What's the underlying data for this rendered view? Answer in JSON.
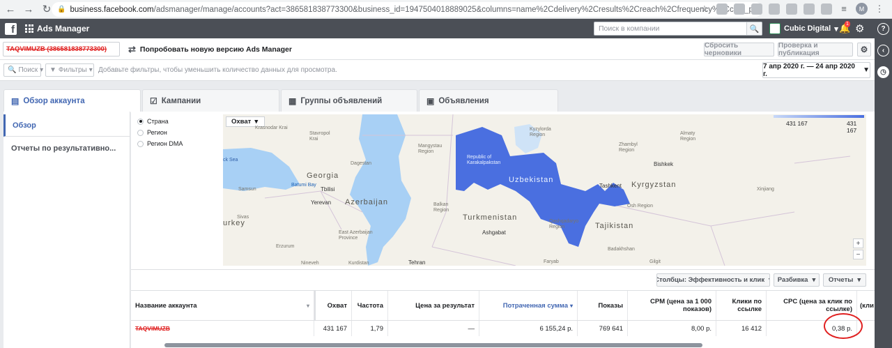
{
  "browser": {
    "url_host": "business.facebook.com",
    "url_path": "/adsmanager/manage/accounts?act=386581838773300&business_id=1947504018889025&columns=name%2Cdelivery%2Cresults%2Creach%2Cfrequency%2Ccost_per_result%2Cbudget%2Cspend%2Cend_...",
    "profile_initial": "M"
  },
  "topbar": {
    "app_title": "Ads Manager",
    "search_placeholder": "Поиск в компании",
    "account_name": "Cubic Digital",
    "notification_count": "1"
  },
  "toolbar": {
    "account_select": "TAQVIMUZB (386581838773300)",
    "try_new": "Попробовать новую версию Ads Manager",
    "reset_drafts": "Сбросить черновики",
    "review_publish": "Проверка и публикация"
  },
  "filters": {
    "search": "Поиск",
    "filters": "Фильтры",
    "hint": "Добавьте фильтры, чтобы уменьшить количество данных для просмотра.",
    "date_range": "7 апр 2020 г. — 24 апр 2020 г."
  },
  "tabs": [
    {
      "label": "Обзор аккаунта"
    },
    {
      "label": "Кампании"
    },
    {
      "label": "Группы объявлений"
    },
    {
      "label": "Объявления"
    }
  ],
  "leftnav": {
    "overview": "Обзор",
    "reports": "Отчеты по результативно..."
  },
  "geo": {
    "options": [
      "Страна",
      "Регион",
      "Регион DMA"
    ],
    "selected": "Страна",
    "metric": "Охват",
    "legend_min": "431 167",
    "legend_max": "431 167",
    "highlight_color": "#4a6fe0",
    "labels": {
      "uzbekistan": "Uzbekistan",
      "karakalpakstan": "Republic of Karakalpakstan",
      "turkmenistan": "Turkmenistan",
      "tajikistan": "Tajikistan",
      "kyrgyzstan": "Kyrgyzstan",
      "georgia": "Georgia",
      "azerbaijan": "Azerbaijan",
      "turkey": "urkey",
      "tashkent": "Tashkent",
      "bishkek": "Bishkek",
      "ashgabat": "Ashgabat",
      "tehran": "Tehran",
      "tbilisi": "Tbilisi",
      "yerevan": "Yerevan",
      "krasnodar": "Krasnodar Krai",
      "stavropol": "Stavropol Krai",
      "dagestan": "Dagestan",
      "mangystau": "Mangystau Region",
      "kyzylorda": "Kyzylorda Region",
      "zhambyl": "Zhambyl Region",
      "almaty": "Almaty Region",
      "balkan": "Balkan Region",
      "east_azerbaijan": "East Azerbaijan Province",
      "qashqadaryo": "Qashqadaryo Region",
      "osh": "Osh Region",
      "badakhshan": "Badakhshan",
      "xinjiang": "Xinjiang",
      "kurdistan": "Kurdistan",
      "gilgit": "Gilgit",
      "faryab": "Faryab",
      "samsun": "Samsun",
      "batumi": "Batumi Bay",
      "black_sea": "ck Sea",
      "sivas": "Sivas",
      "erzurum": "Erzurum",
      "nineveh": "Nineveh"
    }
  },
  "table_tools": {
    "columns": "Столбцы: Эффективность и клик",
    "breakdown": "Разбивка",
    "reports": "Отчеты"
  },
  "table": {
    "headers": {
      "name": "Название аккаунта",
      "reach": "Охват",
      "frequency": "Частота",
      "cost_per_result": "Цена за результат",
      "spend": "Потраченная сумма",
      "impressions": "Показы",
      "cpm": "CPM (цена за 1 000 показов)",
      "link_clicks": "Клики по ссылке",
      "cpc": "CPC (цена за клик по ссылке)",
      "extra": "(кли"
    },
    "row": {
      "name": "TAQVIMUZB",
      "reach": "431 167",
      "frequency": "1,79",
      "cost_per_result": "—",
      "spend": "6 155,24 р.",
      "impressions": "769 641",
      "cpm": "8,00 р.",
      "link_clicks": "16 412",
      "cpc": "0,38 р."
    }
  }
}
